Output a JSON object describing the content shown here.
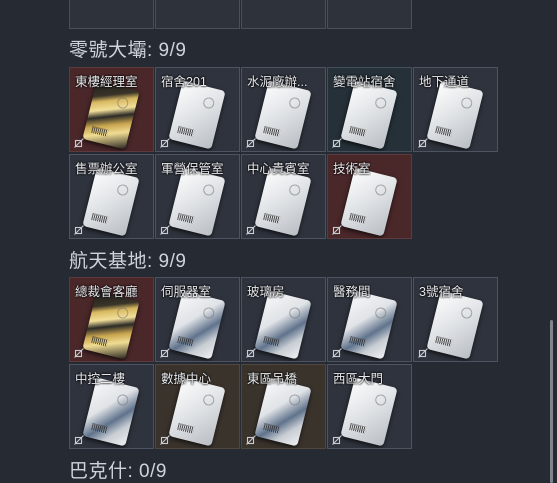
{
  "sections": [
    {
      "title": "零號大壩: 9/9",
      "cards": [
        {
          "label": "東樓經理室",
          "bg": "red",
          "card": "gold"
        },
        {
          "label": "宿舍201",
          "bg": "plain",
          "card": "white"
        },
        {
          "label": "水泥廠辦...",
          "bg": "plain",
          "card": "white"
        },
        {
          "label": "變電站宿舍",
          "bg": "teal",
          "card": "white"
        },
        {
          "label": "地下通道",
          "bg": "plain",
          "card": "white"
        },
        {
          "label": "售票辦公室",
          "bg": "plain",
          "card": "white"
        },
        {
          "label": "軍營保管室",
          "bg": "plain",
          "card": "white"
        },
        {
          "label": "中心貴賓室",
          "bg": "plain",
          "card": "white"
        },
        {
          "label": "技術室",
          "bg": "red",
          "card": "white"
        }
      ]
    },
    {
      "title": "航天基地: 9/9",
      "cards": [
        {
          "label": "總裁會客廳",
          "bg": "red",
          "card": "gold"
        },
        {
          "label": "伺服器室",
          "bg": "plain",
          "card": "shadowed"
        },
        {
          "label": "玻璃房",
          "bg": "plain",
          "card": "shadowed"
        },
        {
          "label": "醫務間",
          "bg": "plain",
          "card": "shadowed"
        },
        {
          "label": "3號宿舍",
          "bg": "plain",
          "card": "white"
        },
        {
          "label": "中控二樓",
          "bg": "plain",
          "card": "shadowed"
        },
        {
          "label": "數據中心",
          "bg": "brown",
          "card": "white"
        },
        {
          "label": "東區吊橋",
          "bg": "brown",
          "card": "shadowed"
        },
        {
          "label": "西區大門",
          "bg": "plain",
          "card": "white"
        }
      ]
    },
    {
      "title": "巴克什: 0/9",
      "cards": []
    }
  ],
  "icons": {
    "card_footer": "unbound-key-icon"
  }
}
